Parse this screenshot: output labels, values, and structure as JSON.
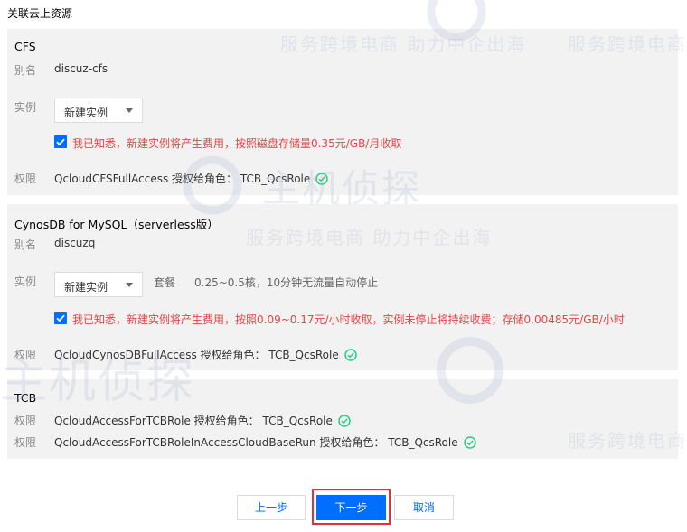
{
  "page_title": "关联云上资源",
  "cfs": {
    "title": "CFS",
    "alias_label": "别名",
    "alias_value": "discuz-cfs",
    "instance_label": "实例",
    "instance_select": "新建实例",
    "notice": "我已知悉，新建实例将产生费用，按照磁盘存储量0.35元/GB/月收取",
    "perm_label": "权限",
    "perm_value": "QcloudCFSFullAccess 授权给角色： TCB_QcsRole"
  },
  "cynos": {
    "title": "CynosDB for MySQL（serverless版）",
    "alias_label": "别名",
    "alias_value": "discuzq",
    "instance_label": "实例",
    "instance_select": "新建实例",
    "package_label": "套餐",
    "package_value": "0.25~0.5核，10分钟无流量自动停止",
    "notice": "我已知悉，新建实例将产生费用，按照0.09~0.17元/小时收取，实例未停止将持续收费；存储0.00485元/GB/小时",
    "perm_label": "权限",
    "perm_value": "QcloudCynosDBFullAccess 授权给角色： TCB_QcsRole"
  },
  "tcb": {
    "title": "TCB",
    "perm_label": "权限",
    "perm_value_1": "QcloudAccessForTCBRole 授权给角色： TCB_QcsRole",
    "perm_value_2": "QcloudAccessForTCBRoleInAccessCloudBaseRun 授权给角色： TCB_QcsRole"
  },
  "footer": {
    "prev_label": "上一步",
    "next_label": "下一步",
    "cancel_label": "取消"
  },
  "watermark": {
    "tagline": "服务跨境电商 助力中企出海",
    "brand": "主机侦探"
  },
  "colors": {
    "primary": "#006eff",
    "warning": "#e54545",
    "success": "#29cc85",
    "highlight": "#e0323a"
  },
  "icons": [
    "check-icon",
    "success-check-icon",
    "caret-down-icon"
  ]
}
